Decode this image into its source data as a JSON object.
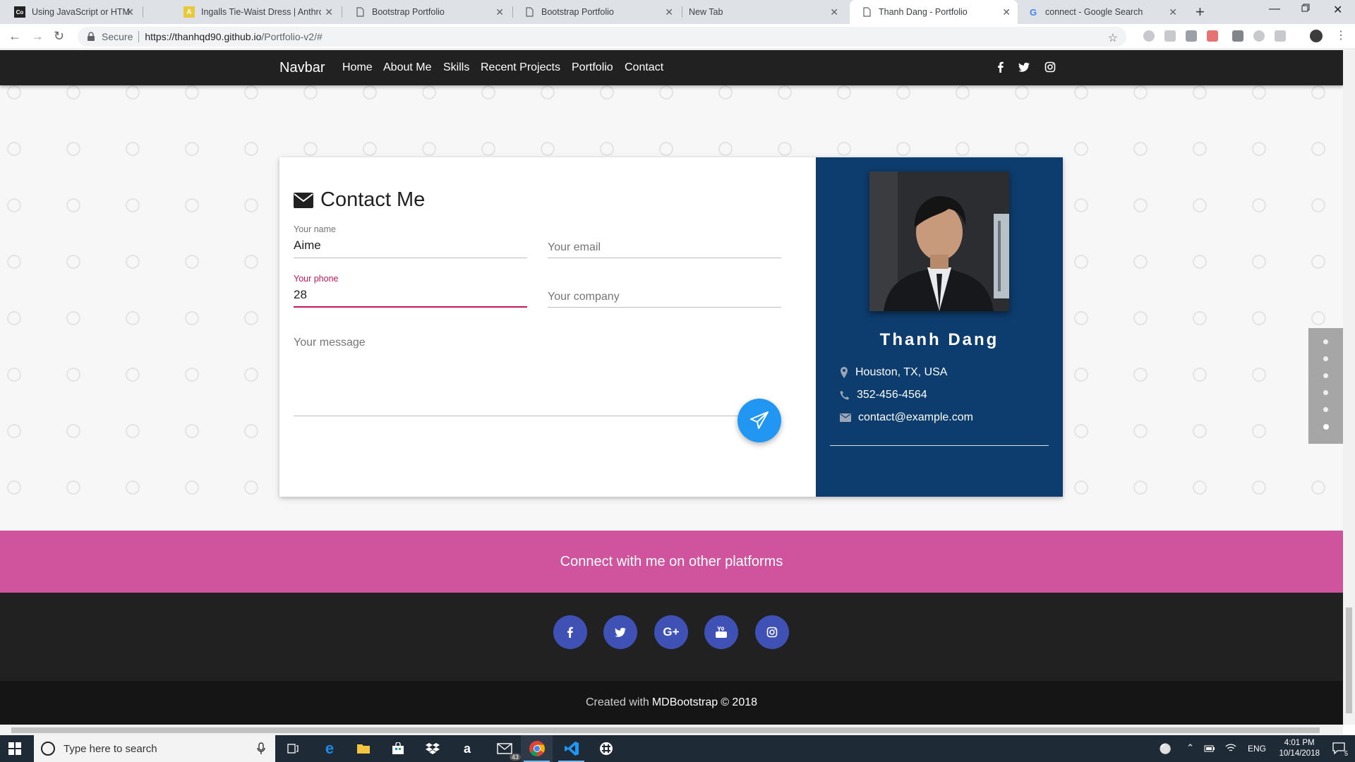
{
  "browser": {
    "tabs": [
      {
        "title": "Using JavaScript or HTML to Targ",
        "favicon": "Co",
        "favicon_bg": "#222"
      },
      {
        "title": "Ingalls Tie-Waist Dress | Anthrop",
        "favicon": "A",
        "favicon_bg": "#e8c93b"
      },
      {
        "title": "Bootstrap Portfolio",
        "favicon": "",
        "favicon_bg": ""
      },
      {
        "title": "Bootstrap Portfolio",
        "favicon": "",
        "favicon_bg": ""
      },
      {
        "title": "New Tab",
        "favicon": "",
        "favicon_bg": ""
      },
      {
        "title": "Thanh Dang - Portfolio",
        "favicon": "",
        "favicon_bg": ""
      },
      {
        "title": "connect - Google Search",
        "favicon": "G",
        "favicon_bg": ""
      }
    ],
    "active_tab_index": 5,
    "secure_label": "Secure",
    "url_host": "https://thanhqd90.github.io",
    "url_path": "/Portfolio-v2/#"
  },
  "navbar": {
    "brand": "Navbar",
    "links": [
      "Home",
      "About Me",
      "Skills",
      "Recent Projects",
      "Portfolio",
      "Contact"
    ],
    "social_icons": [
      "facebook-icon",
      "twitter-icon",
      "instagram-icon"
    ]
  },
  "contact": {
    "heading": "Contact Me",
    "name_label": "Your name",
    "name_value": "Aime",
    "email_placeholder": "Your email",
    "phone_label": "Your phone",
    "phone_value": "28",
    "company_placeholder": "Your company",
    "message_placeholder": "Your message",
    "accent_color": "#c2185b",
    "send_button_color": "#2196f3"
  },
  "profile": {
    "name": "Thanh Dang",
    "location": "Houston, TX, USA",
    "phone": "352-456-4564",
    "email": "contact@example.com",
    "panel_color": "#0d3c6e"
  },
  "section_dots": {
    "count": 6,
    "active_index": 5
  },
  "connect": {
    "text": "Connect with me on other platforms",
    "band_color": "#d0539d"
  },
  "footer": {
    "social_icons": [
      "facebook-icon",
      "twitter-icon",
      "google-plus-icon",
      "youtube-icon",
      "instagram-icon"
    ],
    "copyright_prefix": "Created with",
    "copyright_brand": "MDBootstrap",
    "copyright_suffix": "© 2018"
  },
  "taskbar": {
    "search_placeholder": "Type here to search",
    "mail_badge": "43",
    "language": "ENG",
    "time": "4:01 PM",
    "date": "10/14/2018",
    "notification_count": "5"
  }
}
